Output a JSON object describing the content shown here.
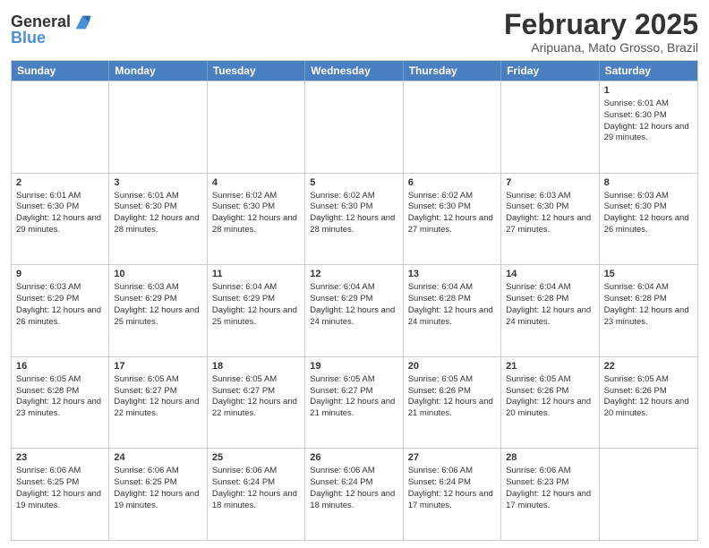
{
  "header": {
    "logo_line1": "General",
    "logo_line2": "Blue",
    "month_title": "February 2025",
    "location": "Aripuana, Mato Grosso, Brazil"
  },
  "weekdays": [
    "Sunday",
    "Monday",
    "Tuesday",
    "Wednesday",
    "Thursday",
    "Friday",
    "Saturday"
  ],
  "weeks": [
    [
      {
        "day": "",
        "info": ""
      },
      {
        "day": "",
        "info": ""
      },
      {
        "day": "",
        "info": ""
      },
      {
        "day": "",
        "info": ""
      },
      {
        "day": "",
        "info": ""
      },
      {
        "day": "",
        "info": ""
      },
      {
        "day": "1",
        "info": "Sunrise: 6:01 AM\nSunset: 6:30 PM\nDaylight: 12 hours and 29 minutes."
      }
    ],
    [
      {
        "day": "2",
        "info": "Sunrise: 6:01 AM\nSunset: 6:30 PM\nDaylight: 12 hours and 29 minutes."
      },
      {
        "day": "3",
        "info": "Sunrise: 6:01 AM\nSunset: 6:30 PM\nDaylight: 12 hours and 28 minutes."
      },
      {
        "day": "4",
        "info": "Sunrise: 6:02 AM\nSunset: 6:30 PM\nDaylight: 12 hours and 28 minutes."
      },
      {
        "day": "5",
        "info": "Sunrise: 6:02 AM\nSunset: 6:30 PM\nDaylight: 12 hours and 28 minutes."
      },
      {
        "day": "6",
        "info": "Sunrise: 6:02 AM\nSunset: 6:30 PM\nDaylight: 12 hours and 27 minutes."
      },
      {
        "day": "7",
        "info": "Sunrise: 6:03 AM\nSunset: 6:30 PM\nDaylight: 12 hours and 27 minutes."
      },
      {
        "day": "8",
        "info": "Sunrise: 6:03 AM\nSunset: 6:30 PM\nDaylight: 12 hours and 26 minutes."
      }
    ],
    [
      {
        "day": "9",
        "info": "Sunrise: 6:03 AM\nSunset: 6:29 PM\nDaylight: 12 hours and 26 minutes."
      },
      {
        "day": "10",
        "info": "Sunrise: 6:03 AM\nSunset: 6:29 PM\nDaylight: 12 hours and 25 minutes."
      },
      {
        "day": "11",
        "info": "Sunrise: 6:04 AM\nSunset: 6:29 PM\nDaylight: 12 hours and 25 minutes."
      },
      {
        "day": "12",
        "info": "Sunrise: 6:04 AM\nSunset: 6:29 PM\nDaylight: 12 hours and 24 minutes."
      },
      {
        "day": "13",
        "info": "Sunrise: 6:04 AM\nSunset: 6:28 PM\nDaylight: 12 hours and 24 minutes."
      },
      {
        "day": "14",
        "info": "Sunrise: 6:04 AM\nSunset: 6:28 PM\nDaylight: 12 hours and 24 minutes."
      },
      {
        "day": "15",
        "info": "Sunrise: 6:04 AM\nSunset: 6:28 PM\nDaylight: 12 hours and 23 minutes."
      }
    ],
    [
      {
        "day": "16",
        "info": "Sunrise: 6:05 AM\nSunset: 6:28 PM\nDaylight: 12 hours and 23 minutes."
      },
      {
        "day": "17",
        "info": "Sunrise: 6:05 AM\nSunset: 6:27 PM\nDaylight: 12 hours and 22 minutes."
      },
      {
        "day": "18",
        "info": "Sunrise: 6:05 AM\nSunset: 6:27 PM\nDaylight: 12 hours and 22 minutes."
      },
      {
        "day": "19",
        "info": "Sunrise: 6:05 AM\nSunset: 6:27 PM\nDaylight: 12 hours and 21 minutes."
      },
      {
        "day": "20",
        "info": "Sunrise: 6:05 AM\nSunset: 6:26 PM\nDaylight: 12 hours and 21 minutes."
      },
      {
        "day": "21",
        "info": "Sunrise: 6:05 AM\nSunset: 6:26 PM\nDaylight: 12 hours and 20 minutes."
      },
      {
        "day": "22",
        "info": "Sunrise: 6:05 AM\nSunset: 6:26 PM\nDaylight: 12 hours and 20 minutes."
      }
    ],
    [
      {
        "day": "23",
        "info": "Sunrise: 6:06 AM\nSunset: 6:25 PM\nDaylight: 12 hours and 19 minutes."
      },
      {
        "day": "24",
        "info": "Sunrise: 6:06 AM\nSunset: 6:25 PM\nDaylight: 12 hours and 19 minutes."
      },
      {
        "day": "25",
        "info": "Sunrise: 6:06 AM\nSunset: 6:24 PM\nDaylight: 12 hours and 18 minutes."
      },
      {
        "day": "26",
        "info": "Sunrise: 6:06 AM\nSunset: 6:24 PM\nDaylight: 12 hours and 18 minutes."
      },
      {
        "day": "27",
        "info": "Sunrise: 6:06 AM\nSunset: 6:24 PM\nDaylight: 12 hours and 17 minutes."
      },
      {
        "day": "28",
        "info": "Sunrise: 6:06 AM\nSunset: 6:23 PM\nDaylight: 12 hours and 17 minutes."
      },
      {
        "day": "",
        "info": ""
      }
    ]
  ]
}
